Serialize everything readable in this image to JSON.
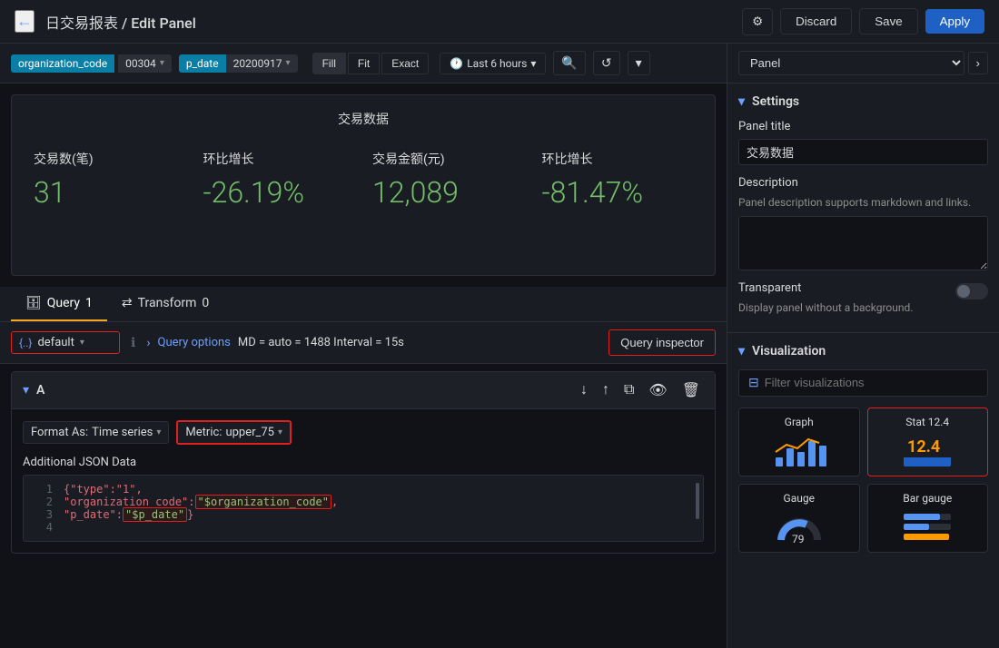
{
  "header": {
    "back_icon": "←",
    "breadcrumb": "日交易报表 / Edit Panel",
    "gear_icon": "⚙",
    "discard_label": "Discard",
    "save_label": "Save",
    "apply_label": "Apply"
  },
  "toolbar": {
    "filter1_label": "organization_code",
    "filter1_value": "00304",
    "filter2_label": "p_date",
    "filter2_value": "20200917",
    "fill_label": "Fill",
    "fit_label": "Fit",
    "exact_label": "Exact",
    "time_range_label": "Last 6 hours",
    "zoom_icon": "🔍",
    "refresh_icon": "↺",
    "more_icon": "▾"
  },
  "stats_panel": {
    "title": "交易数据",
    "stats": [
      {
        "label": "交易数(笔)",
        "value": "31"
      },
      {
        "label": "环比增长",
        "value": "-26.19%"
      },
      {
        "label": "交易金额(元)",
        "value": "12,089"
      },
      {
        "label": "环比增长",
        "value": "-81.47%"
      }
    ]
  },
  "query_tabs": {
    "query_label": "Query",
    "query_count": "1",
    "transform_label": "Transform",
    "transform_count": "0"
  },
  "query_bar": {
    "datasource_icon": "{..}",
    "datasource_label": "default",
    "chevron": "▾",
    "info_icon": "ℹ",
    "arrow_icon": "›",
    "query_options_label": "Query options",
    "query_meta": "MD = auto = 1488   Interval = 15s",
    "query_inspector_label": "Query inspector"
  },
  "query_section": {
    "section_label": "A",
    "format_label": "Format As:",
    "format_value": "Time series",
    "metric_label": "Metric:",
    "metric_value": "upper_75",
    "additional_json_label": "Additional JSON Data",
    "json_lines": [
      {
        "num": "1",
        "text": "{\"type\":\"1\","
      },
      {
        "num": "2",
        "text": "\"organization_code\":\"$organization_code\","
      },
      {
        "num": "3",
        "text": "\"p_date\":\"$p_date\"}"
      },
      {
        "num": "4",
        "text": ""
      }
    ]
  },
  "right_panel": {
    "panel_label": "Panel",
    "settings_title": "Settings",
    "panel_title_label": "Panel title",
    "panel_title_value": "交易数据",
    "description_label": "Description",
    "description_desc": "Panel description supports markdown and links.",
    "transparent_label": "Transparent",
    "transparent_desc": "Display panel without a background.",
    "visualization_title": "Visualization",
    "vis_filter_placeholder": "Filter visualizations",
    "visualizations": [
      {
        "id": "graph",
        "label": "Graph",
        "active": false
      },
      {
        "id": "stat",
        "label": "Stat 12.4",
        "active": true
      },
      {
        "id": "gauge",
        "label": "Gauge",
        "active": false
      },
      {
        "id": "bar-gauge",
        "label": "Bar gauge",
        "active": false
      }
    ]
  }
}
